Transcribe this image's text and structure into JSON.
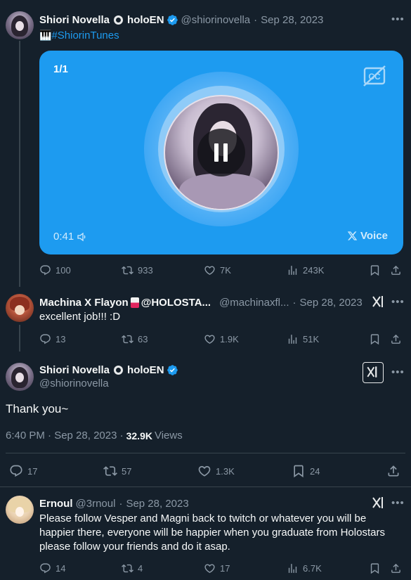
{
  "tweet1": {
    "display_name": "Shiori Novella",
    "affiliation": "holoEN",
    "handle": "@shiorinovella",
    "date": "Sep 28, 2023",
    "text_emoji": "🎹",
    "hashtag": "#ShiorinTunes",
    "media": {
      "counter": "1/1",
      "duration": "0:41",
      "brand": "Voice",
      "bg_color": "#1d9bf0"
    },
    "actions": {
      "replies": "100",
      "retweets": "933",
      "likes": "7K",
      "views": "243K"
    }
  },
  "tweet2": {
    "display_name": "Machina X Flayon",
    "display_suffix": "@HOLOSTA...",
    "handle": "@machinaxfl...",
    "date": "Sep 28, 2023",
    "text": "excellent job!!! :D",
    "actions": {
      "replies": "13",
      "retweets": "63",
      "likes": "1.9K",
      "views": "51K"
    }
  },
  "main_tweet": {
    "display_name": "Shiori Novella",
    "affiliation": "holoEN",
    "handle": "@shiorinovella",
    "text": "Thank you~",
    "time": "6:40 PM · Sep 28, 2023 ·",
    "views_count": "32.9K",
    "views_label": "Views",
    "actions": {
      "replies": "17",
      "retweets": "57",
      "likes": "1.3K",
      "bookmarks": "24"
    }
  },
  "reply": {
    "display_name": "Ernoul",
    "handle": "@3rnoul",
    "date": "Sep 28, 2023",
    "text": "Please follow Vesper and Magni back to twitch or whatever you will be happier there, everyone will be happier when you graduate from Holostars please follow your friends and do it asap.",
    "actions": {
      "replies": "14",
      "retweets": "4",
      "likes": "17",
      "views": "6.7K"
    }
  }
}
